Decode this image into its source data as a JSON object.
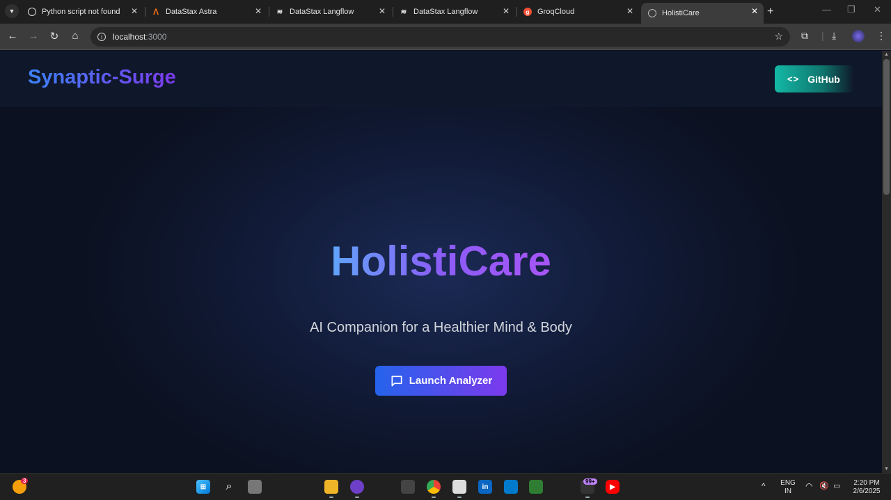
{
  "browser": {
    "tabs": [
      {
        "title": "Python script not found",
        "icon": "openai-icon"
      },
      {
        "title": "DataStax Astra",
        "icon": "astra-icon"
      },
      {
        "title": "DataStax Langflow",
        "icon": "langflow-icon"
      },
      {
        "title": "DataStax Langflow",
        "icon": "langflow-icon"
      },
      {
        "title": "GroqCloud",
        "icon": "groq-icon"
      },
      {
        "title": "HolistiCare",
        "icon": "globe-icon",
        "active": true
      }
    ],
    "url_host": "localhost",
    "url_port": ":3000"
  },
  "site": {
    "brand": "Synaptic-Surge",
    "github_label": "GitHub",
    "hero_title": "HolistiCare",
    "hero_subtitle": "AI Companion for a Healthier Mind & Body",
    "cta_label": "Launch Analyzer"
  },
  "colors": {
    "background": "#0b1120",
    "header": "#0f172a",
    "brand_gradient_start": "#3b82f6",
    "brand_gradient_end": "#7c3aed",
    "github_button": "#14b8a6",
    "cta_gradient_start": "#2563eb",
    "cta_gradient_end": "#7c3aed"
  },
  "taskbar": {
    "notification_badge": "3",
    "store_badge": "99+",
    "language": "ENG",
    "region": "IN",
    "time": "2:20 PM",
    "date": "2/6/2025"
  }
}
